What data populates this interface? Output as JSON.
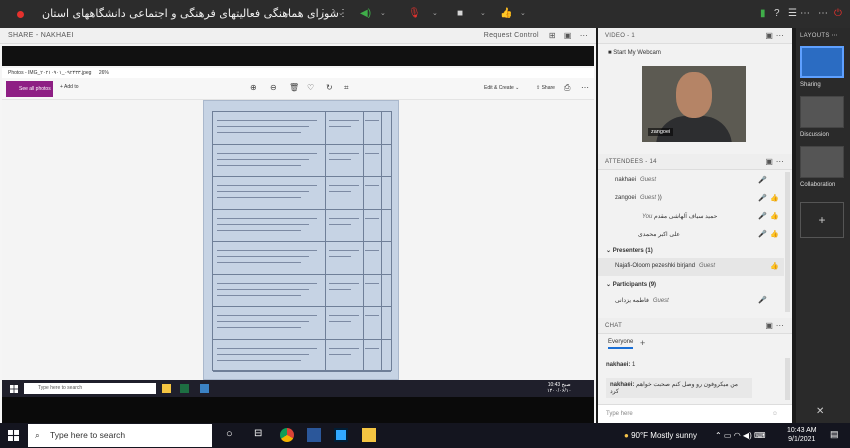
{
  "topbar": {
    "title": "شورای هماهنگی فعالیتهای فرهنگی و اجتماعی دانشگاههای استان",
    "colors": {
      "record": "#e5312d",
      "accent_green": "#3fae49"
    }
  },
  "share_pod": {
    "header": "SHARE - NAKHAEI",
    "request_control": "Request Control",
    "photos_title": "Photos - IMG_۲۰۲۱۰۹۰۱_۰۹۲۴۳۳.jpeg",
    "zoom": "26%",
    "see_all": "See all photos",
    "add_to": "Add to",
    "edit_create": "Edit & Create",
    "share": "Share",
    "inner_search": "Type here to search",
    "inner_time": "10:43 صبح",
    "inner_date": "۱۴۰۰/۰۶/۱۰"
  },
  "video_pod": {
    "header": "VIDEO - 1",
    "start_webcam": "Start My Webcam",
    "participant_label": "zangoei"
  },
  "attendees_pod": {
    "header": "ATTENDEES - 14",
    "hosts": [
      {
        "name": "nakhaei",
        "role": "Guest"
      },
      {
        "name": "zangoei",
        "role": "Guest"
      },
      {
        "name": "حمید سیاف آلهاشی مقدم",
        "role": "You"
      },
      {
        "name": "علی اکبر محمدی",
        "role": ""
      }
    ],
    "presenters_label": "Presenters (1)",
    "presenters": [
      {
        "name": "Najafi-Oloom pezeshki birjand",
        "role": "Guest"
      }
    ],
    "participants_label": "Participants (9)",
    "participants": [
      {
        "name": "فاطمه یزدانی",
        "role": "Guest"
      }
    ]
  },
  "chat_pod": {
    "header": "CHAT",
    "tab": "Everyone",
    "messages": [
      {
        "sender": "nakhaei:",
        "text": "1"
      },
      {
        "sender": "nakhaei:",
        "text": "من میکروفون رو وصل کنم صحبت خواهم کرد"
      }
    ],
    "input_placeholder": "Type here"
  },
  "layouts": {
    "title": "LAYOUTS",
    "items": [
      "Sharing",
      "Discussion",
      "Collaboration"
    ]
  },
  "taskbar": {
    "search_placeholder": "Type here to search",
    "weather": "90°F  Mostly sunny",
    "time": "10:43 AM",
    "date": "9/1/2021"
  }
}
